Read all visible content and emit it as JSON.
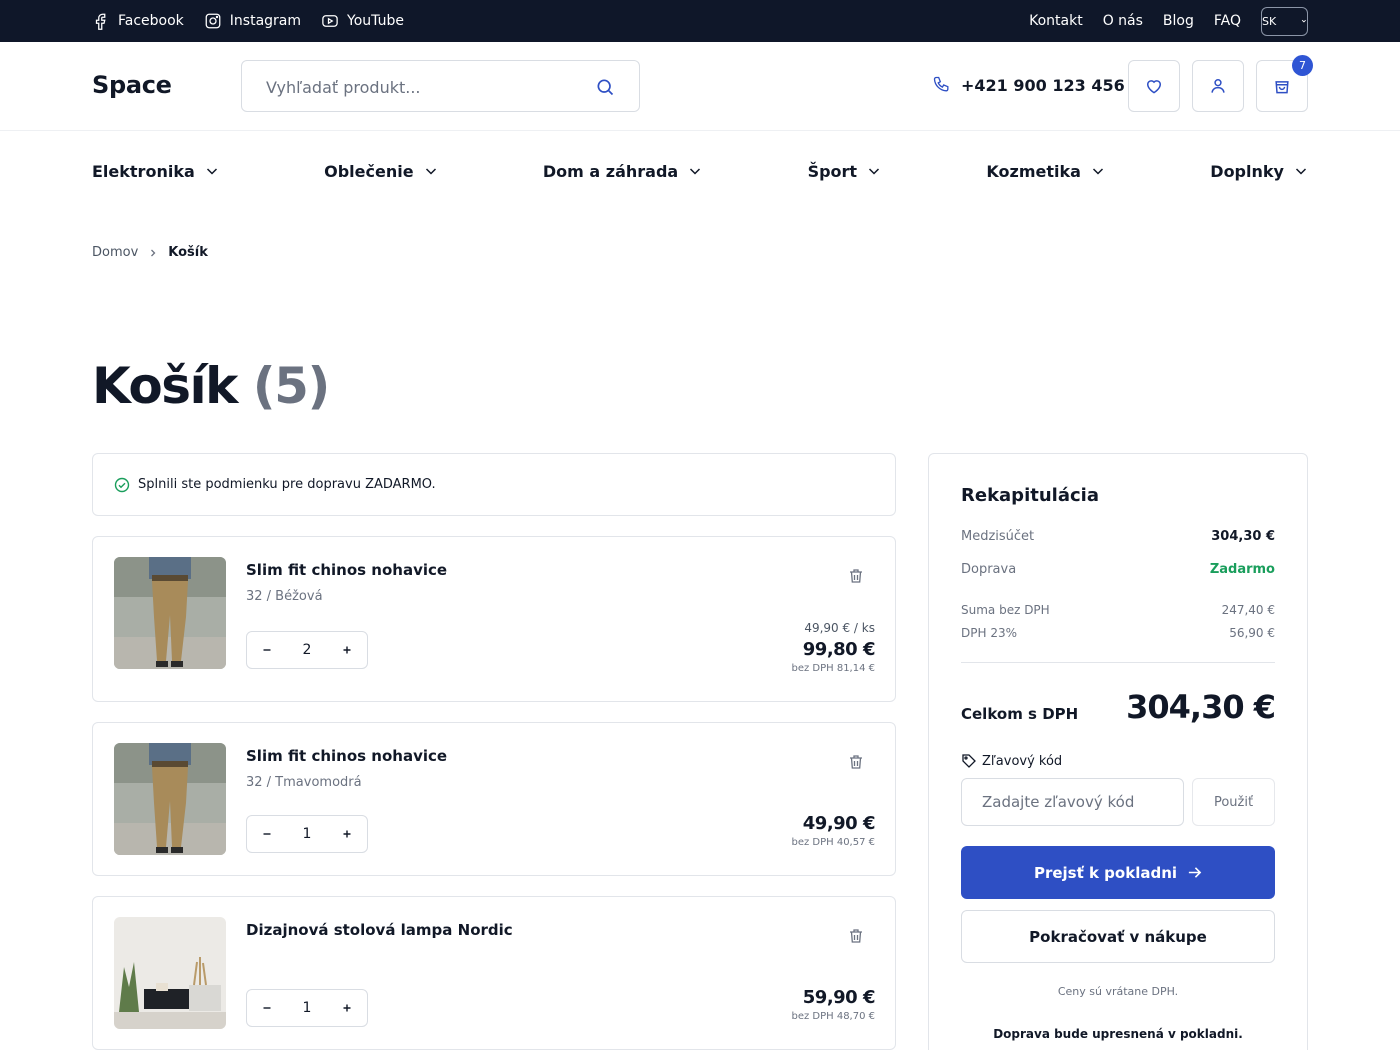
{
  "topbar": {
    "social": [
      {
        "label": "Facebook",
        "icon": "facebook-icon"
      },
      {
        "label": "Instagram",
        "icon": "instagram-icon"
      },
      {
        "label": "YouTube",
        "icon": "youtube-icon"
      }
    ],
    "links": [
      "Kontakt",
      "O nás",
      "Blog",
      "FAQ"
    ],
    "language": "SK"
  },
  "header": {
    "logo": "Space",
    "search_placeholder": "Vyhľadať produkt...",
    "phone": "+421 900 123 456",
    "cart_count": "7"
  },
  "categories": [
    "Elektronika",
    "Oblečenie",
    "Dom a záhrada",
    "Šport",
    "Kozmetika",
    "Doplnky"
  ],
  "breadcrumb": {
    "home": "Domov",
    "current": "Košík"
  },
  "page": {
    "title": "Košík",
    "count": "(5)"
  },
  "notice": "Splnili ste podmienku pre dopravu ZADARMO.",
  "items": [
    {
      "name": "Slim fit chinos nohavice",
      "variant": "32 / Béžová",
      "qty": "2",
      "unit_price": "49,90 € / ks",
      "total": "99,80 €",
      "net": "bez DPH 81,14 €"
    },
    {
      "name": "Slim fit chinos nohavice",
      "variant": "32 / Tmavomodrá",
      "qty": "1",
      "unit_price": "",
      "total": "49,90 €",
      "net": "bez DPH 40,57 €"
    },
    {
      "name": "Dizajnová stolová lampa Nordic",
      "variant": "",
      "qty": "1",
      "unit_price": "",
      "total": "59,90 €",
      "net": "bez DPH 48,70 €"
    }
  ],
  "summary": {
    "title": "Rekapitulácia",
    "subtotal_label": "Medzisúčet",
    "subtotal_value": "304,30 €",
    "shipping_label": "Doprava",
    "shipping_value": "Zadarmo",
    "net_label": "Suma bez DPH",
    "net_value": "247,40 €",
    "vat_label": "DPH 23%",
    "vat_value": "56,90 €",
    "grand_label": "Celkom s DPH",
    "grand_value": "304,30 €",
    "promo_label": "Zľavový kód",
    "promo_placeholder": "Zadajte zľavový kód",
    "promo_button": "Použiť",
    "checkout_button": "Prejsť k pokladni",
    "continue_button": "Pokračovať v nákupe",
    "note_prices": "Ceny sú vrátane DPH.",
    "note_shipping": "Doprava bude upresnená v pokladni."
  },
  "colors": {
    "topbar": "#0f1729",
    "primary": "#2e4fc4",
    "success": "#1a9e5c",
    "badge": "#2f55d4"
  }
}
